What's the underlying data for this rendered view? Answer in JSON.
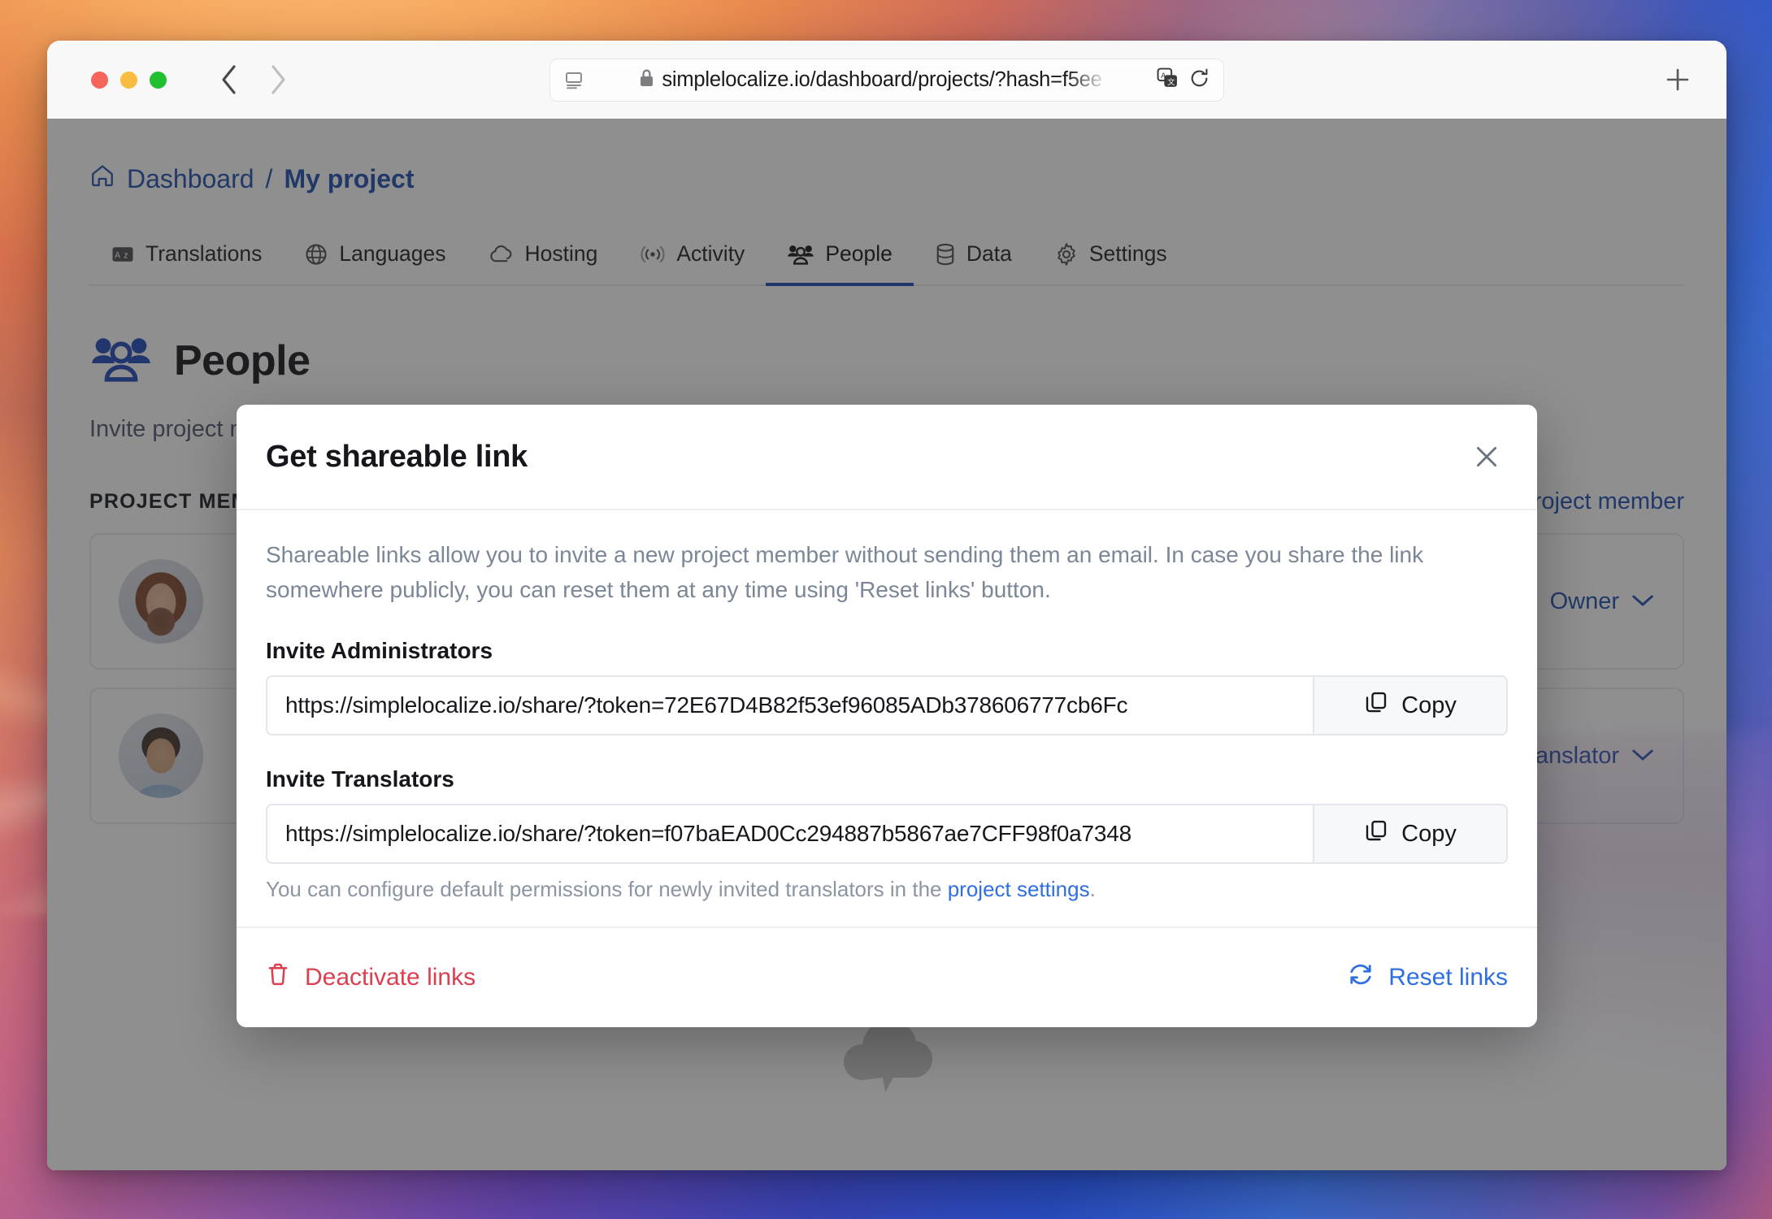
{
  "browser": {
    "window_controls": [
      "close",
      "minimize",
      "zoom"
    ],
    "back_label": "Back",
    "forward_label": "Forward",
    "url": "simplelocalize.io/dashboard/projects/?hash=f5ee",
    "reader_icon": "reader-view-icon",
    "lock_icon": "lock-icon",
    "translate_icon": "translate-icon",
    "reload_icon": "reload-icon",
    "new_tab_label": "+"
  },
  "app": {
    "breadcrumb": {
      "home_icon": "home-icon",
      "root": "Dashboard",
      "separator": "/",
      "current": "My project"
    },
    "tabs": [
      {
        "label": "Translations",
        "icon": "translations-icon",
        "active": false
      },
      {
        "label": "Languages",
        "icon": "globe-icon",
        "active": false
      },
      {
        "label": "Hosting",
        "icon": "cloud-icon",
        "active": false
      },
      {
        "label": "Activity",
        "icon": "activity-icon",
        "active": false
      },
      {
        "label": "People",
        "icon": "people-icon",
        "active": true
      },
      {
        "label": "Data",
        "icon": "database-icon",
        "active": false
      },
      {
        "label": "Settings",
        "icon": "gear-icon",
        "active": false
      }
    ],
    "people": {
      "heading": "People",
      "description": "Invite project members and manage their permissions. You can also use the organization team members to grant access.",
      "section_title": "PROJECT MEMBERS",
      "invite_link": "Invite project member",
      "members": [
        {
          "avatar": "avatar-female",
          "role": "Owner",
          "chevron": "chevron-down-icon"
        },
        {
          "avatar": "avatar-male",
          "role": "Translator",
          "chevron": "chevron-down-icon"
        }
      ],
      "empty_icon": "cloud-icon"
    }
  },
  "modal": {
    "title": "Get shareable link",
    "close_icon": "close-icon",
    "description": "Shareable links allow you to invite a new project member without sending them an email. In case you share the link somewhere publicly, you can reset them at any time using 'Reset links' button.",
    "fields": [
      {
        "label": "Invite Administrators",
        "value": "https://simplelocalize.io/share/?token=72E67D4B82f53ef96085ADb378606777cb6Fc",
        "copy_label": "Copy",
        "copy_icon": "copy-icon"
      },
      {
        "label": "Invite Translators",
        "value": "https://simplelocalize.io/share/?token=f07baEAD0Cc294887b5867ae7CFF98f0a7348",
        "copy_label": "Copy",
        "copy_icon": "copy-icon"
      }
    ],
    "helper": {
      "prefix": "You can configure default permissions for newly invited translators in the ",
      "link": "project settings",
      "suffix": "."
    },
    "footer": {
      "deactivate_label": "Deactivate links",
      "deactivate_icon": "trash-icon",
      "reset_label": "Reset links",
      "reset_icon": "refresh-icon"
    }
  },
  "colors": {
    "accent_blue": "#1b45b5",
    "link_blue": "#2f6fe0",
    "danger_red": "#dc3f4f",
    "breadcrumb_blue": "#1b4dad"
  }
}
